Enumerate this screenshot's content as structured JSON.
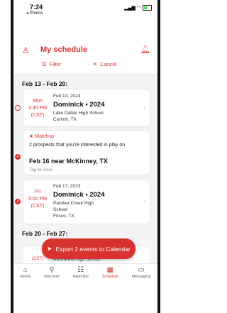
{
  "status": {
    "time": "7:24",
    "back": "◂ Photos"
  },
  "header": {
    "title": "My schedule",
    "filter_label": "Filter",
    "cancel_label": "Cancel"
  },
  "sections": [
    {
      "label": "Feb 13 - Feb 20:"
    },
    {
      "label": "Feb 20 - Feb 27:"
    }
  ],
  "events": [
    {
      "day": "Mon",
      "time": "4:30 PM",
      "tz": "(CST)",
      "date": "Feb 13, 2023",
      "title": "Dominick • 2024",
      "loc1": "Lake Dallas High School",
      "loc2": "Corinth, TX",
      "checked": false
    },
    {
      "day": "Fri",
      "time": "5:00 PM",
      "tz": "(CST)",
      "date": "Feb 17, 2023",
      "title": "Dominick • 2024",
      "loc1": "Panther Creek High",
      "loc2": "School",
      "loc3": "Frisco, TX",
      "checked": true
    }
  ],
  "matchup": {
    "label": "Matchup",
    "text": "2 prospects that you're interested in play on",
    "title": "Feb 16 near McKinney, TX",
    "tap": "Tap to view"
  },
  "peek": {
    "time": "(CST)",
    "loc": "Northwest High School"
  },
  "export_label": "Export 2 events to Calendar",
  "tabs": [
    {
      "label": "Home",
      "icon": "home-icon"
    },
    {
      "label": "Discover",
      "icon": "search-icon"
    },
    {
      "label": "Watchlist",
      "icon": "list-icon"
    },
    {
      "label": "Schedule",
      "icon": "calendar-icon",
      "active": true
    },
    {
      "label": "Messaging",
      "icon": "chat-icon"
    }
  ],
  "colors": {
    "accent": "#d8322f"
  }
}
